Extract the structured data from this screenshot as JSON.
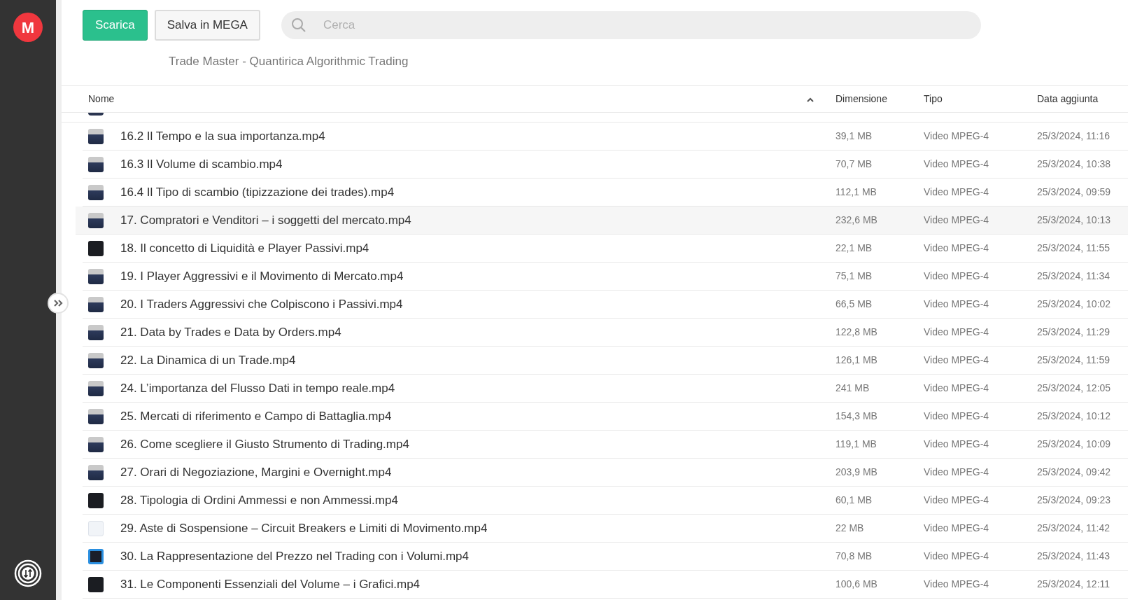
{
  "sidebar": {
    "logo": "M"
  },
  "toolbar": {
    "buttons": [
      {
        "label": "Scarica",
        "kind": "primary"
      },
      {
        "label": "Salva in MEGA",
        "kind": "secondary"
      }
    ],
    "search": {
      "placeholder": "Cerca"
    }
  },
  "folder_title": "Trade Master - Quantirica Algorithmic Trading",
  "table": {
    "columns": [
      "Nome",
      "Dimensione",
      "Tipo",
      "Data aggiunta"
    ],
    "rows": [
      {
        "name": "16.2 Il Tempo e la sua importanza.mp4",
        "size": "39,1 MB",
        "type": "Video MPEG-4",
        "date": "25/3/2024, 11:16",
        "kind": "person",
        "selected": false
      },
      {
        "name": "16.3 Il Volume di scambio.mp4",
        "size": "70,7 MB",
        "type": "Video MPEG-4",
        "date": "25/3/2024, 10:38",
        "kind": "person",
        "selected": false
      },
      {
        "name": "16.4 Il Tipo di scambio (tipizzazione dei trades).mp4",
        "size": "112,1 MB",
        "type": "Video MPEG-4",
        "date": "25/3/2024, 09:59",
        "kind": "person",
        "selected": false
      },
      {
        "name": "17. Compratori e Venditori – i soggetti del mercato.mp4",
        "size": "232,6 MB",
        "type": "Video MPEG-4",
        "date": "25/3/2024, 10:13",
        "kind": "person",
        "selected": true
      },
      {
        "name": "18. Il concetto di Liquidità e Player Passivi.mp4",
        "size": "22,1 MB",
        "type": "Video MPEG-4",
        "date": "25/3/2024, 11:55",
        "kind": "dark",
        "selected": false
      },
      {
        "name": "19. I Player Aggressivi e il Movimento di Mercato.mp4",
        "size": "75,1 MB",
        "type": "Video MPEG-4",
        "date": "25/3/2024, 11:34",
        "kind": "person",
        "selected": false
      },
      {
        "name": "20. I Traders Aggressivi che Colpiscono i Passivi.mp4",
        "size": "66,5 MB",
        "type": "Video MPEG-4",
        "date": "25/3/2024, 10:02",
        "kind": "person",
        "selected": false
      },
      {
        "name": "21. Data by Trades e Data by Orders.mp4",
        "size": "122,8 MB",
        "type": "Video MPEG-4",
        "date": "25/3/2024, 11:29",
        "kind": "person",
        "selected": false
      },
      {
        "name": "22. La Dinamica di un Trade.mp4",
        "size": "126,1 MB",
        "type": "Video MPEG-4",
        "date": "25/3/2024, 11:59",
        "kind": "person",
        "selected": false
      },
      {
        "name": "24. L’importanza del Flusso Dati in tempo reale.mp4",
        "size": "241 MB",
        "type": "Video MPEG-4",
        "date": "25/3/2024, 12:05",
        "kind": "person",
        "selected": false
      },
      {
        "name": "25. Mercati di riferimento e Campo di Battaglia.mp4",
        "size": "154,3 MB",
        "type": "Video MPEG-4",
        "date": "25/3/2024, 10:12",
        "kind": "person",
        "selected": false
      },
      {
        "name": "26. Come scegliere il Giusto Strumento di Trading.mp4",
        "size": "119,1 MB",
        "type": "Video MPEG-4",
        "date": "25/3/2024, 10:09",
        "kind": "person",
        "selected": false
      },
      {
        "name": "27. Orari di Negoziazione, Margini e Overnight.mp4",
        "size": "203,9 MB",
        "type": "Video MPEG-4",
        "date": "25/3/2024, 09:42",
        "kind": "person",
        "selected": false
      },
      {
        "name": "28. Tipologia di Ordini Ammessi e non Ammessi.mp4",
        "size": "60,1 MB",
        "type": "Video MPEG-4",
        "date": "25/3/2024, 09:23",
        "kind": "dark",
        "selected": false
      },
      {
        "name": "29. Aste di Sospensione – Circuit Breakers e Limiti di Movimento.mp4",
        "size": "22 MB",
        "type": "Video MPEG-4",
        "date": "25/3/2024, 11:42",
        "kind": "light",
        "selected": false
      },
      {
        "name": "30. La Rappresentazione del Prezzo nel Trading con i Volumi.mp4",
        "size": "70,8 MB",
        "type": "Video MPEG-4",
        "date": "25/3/2024, 11:43",
        "kind": "blue",
        "selected": false
      },
      {
        "name": "31. Le Componenti Essenziali del Volume – i Grafici.mp4",
        "size": "100,6 MB",
        "type": "Video MPEG-4",
        "date": "25/3/2024, 12:11",
        "kind": "dark",
        "selected": false
      }
    ]
  }
}
